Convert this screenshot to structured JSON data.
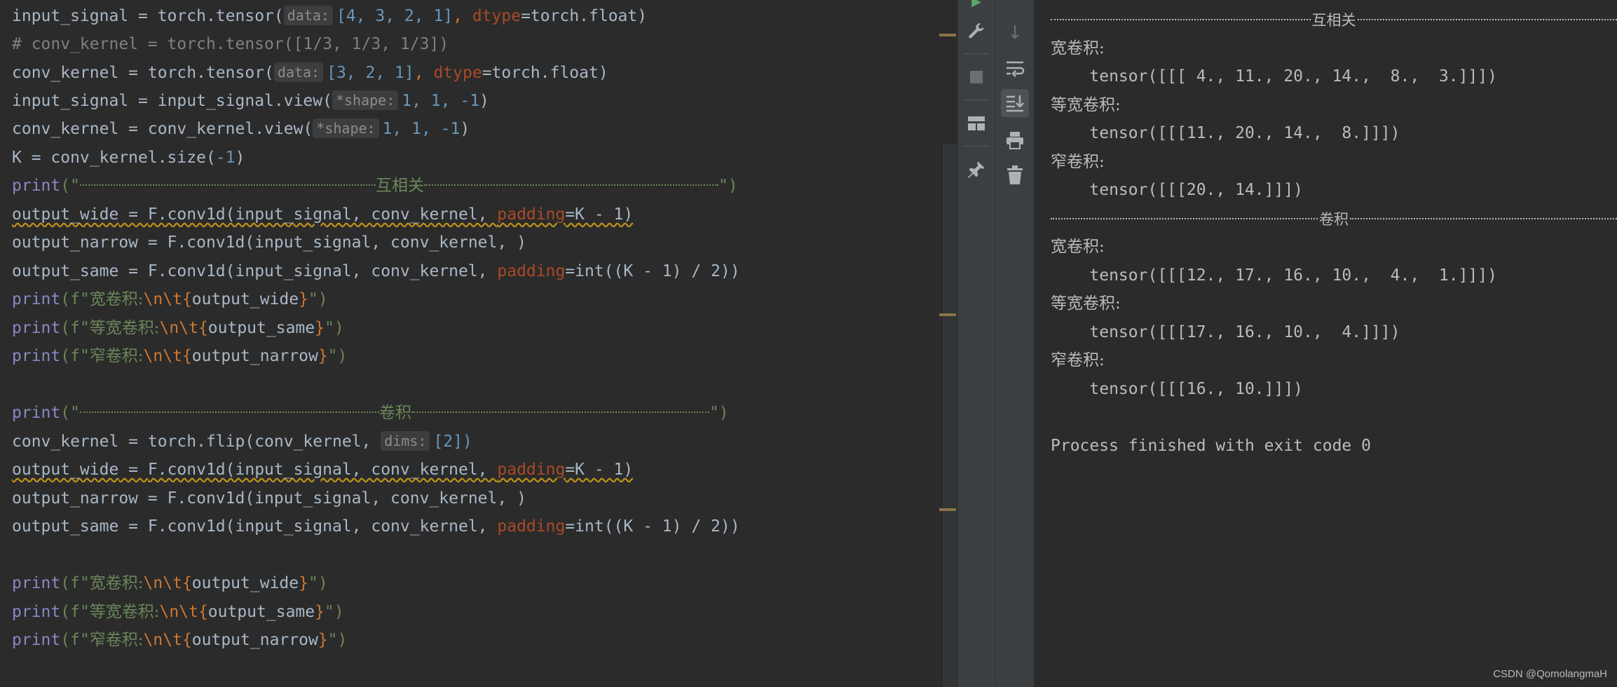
{
  "editor": {
    "hint_data": "data:",
    "hint_shape": "*shape:",
    "hint_dims": "dims:",
    "t_input_signal": "input_signal",
    "t_conv_kernel": "conv_kernel",
    "t_eq": " = ",
    "t_tensor_call": "torch.tensor(",
    "t_input_vals": "[4, 3, 2, 1]",
    "t_kernel_vals": "[3, 2, 1]",
    "t_comma": ", ",
    "t_dtype": "dtype",
    "t_dtype_val": "=torch.float)",
    "comment": "# conv_kernel = torch.tensor([1/3, 1/3, 1/3])",
    "t_view_input": "input_signal.view(",
    "t_view_kernel": "conv_kernel.view(",
    "t_view_args": "1, 1, -1",
    "t_close": ")",
    "t_k_line": "K = conv_kernel.size(",
    "t_neg1": "-1",
    "t_print": "print",
    "t_print_open": "(\"",
    "t_print_close": "\")",
    "t_fprint_open": "(f\"",
    "corr_label": "互相关",
    "conv_label": "卷积",
    "t_out_wide": "output_wide",
    "t_out_narrow": "output_narrow",
    "t_out_same": "output_same",
    "t_conv1d": "F.conv1d(input_signal, conv_kernel, ",
    "t_padding": "padding",
    "t_pad_wide": "=K - 1)",
    "t_narrow_end": ")",
    "t_pad_same_a": "=int((K - 1) / 2))",
    "lbl_wide": "宽卷积:",
    "lbl_same": "等宽卷积:",
    "lbl_narrow": "窄卷积:",
    "t_esc": "\\n\\t",
    "t_brace_open": "{",
    "t_brace_close": "}",
    "t_flip": "torch.flip(conv_kernel, ",
    "t_flip_arg": "[2])"
  },
  "toolbar": {
    "icons": [
      "run-icon",
      "wrench-icon",
      "stop-icon",
      "layout-icon",
      "pin-icon",
      "down-arrow-icon",
      "soft-wrap-icon",
      "scroll-to-end-icon",
      "print-icon",
      "trash-icon"
    ]
  },
  "console": {
    "corr_header": "互相关",
    "conv_header": "卷积",
    "wide_label": "宽卷积:",
    "same_label": "等宽卷积:",
    "narrow_label": "窄卷积:",
    "corr_wide": "    tensor([[[ 4., 11., 20., 14.,  8.,  3.]]])",
    "corr_same": "    tensor([[[11., 20., 14.,  8.]]])",
    "corr_narrow": "    tensor([[[20., 14.]]])",
    "conv_wide": "    tensor([[[12., 17., 16., 10.,  4.,  1.]]])",
    "conv_same": "    tensor([[[17., 16., 10.,  4.]]])",
    "conv_narrow": "    tensor([[[16., 10.]]])",
    "exit": "Process finished with exit code 0"
  },
  "watermark": "CSDN @QomolangmaH"
}
